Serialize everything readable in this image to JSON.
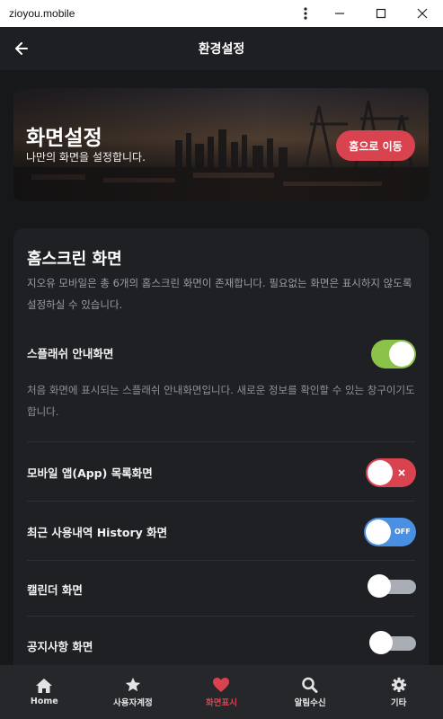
{
  "window": {
    "title": "zioyou.mobile"
  },
  "header": {
    "title": "환경설정"
  },
  "hero": {
    "title": "화면설정",
    "subtitle": "나만의 화면을 설정합니다.",
    "home_button": "홈으로 이동"
  },
  "card": {
    "title": "홈스크린 화면",
    "description": "지오유 모바일은 총 6개의 홈스크린 화면이 존재합니다. 필요없는 화면은 표시하지 않도록 설정하실 수 있습니다.",
    "settings": [
      {
        "label": "스플래쉬 안내화면",
        "description": "처음 화면에 표시되는 스플래쉬 안내화면입니다. 새로운 정보를 확인할 수 있는 창구이기도 합니다.",
        "state": "on"
      },
      {
        "label": "모바일 앱(App) 목록화면",
        "state": "off-x"
      },
      {
        "label": "최근 사용내역 History 화면",
        "state": "off-label",
        "state_text": "OFF"
      },
      {
        "label": "캘린더 화면",
        "state": "off"
      },
      {
        "label": "공지사항 화면",
        "state": "off"
      }
    ]
  },
  "nav": {
    "items": [
      {
        "label": "Home",
        "icon": "home-icon"
      },
      {
        "label": "사용자계정",
        "icon": "star-icon"
      },
      {
        "label": "화면표시",
        "icon": "heart-icon",
        "active": true
      },
      {
        "label": "알림수신",
        "icon": "search-icon"
      },
      {
        "label": "기타",
        "icon": "gear-icon"
      }
    ]
  },
  "colors": {
    "accent": "#d9424f",
    "toggle_on": "#8bc34a",
    "toggle_blue": "#4a90e2",
    "toggle_off": "#a9adb5"
  }
}
